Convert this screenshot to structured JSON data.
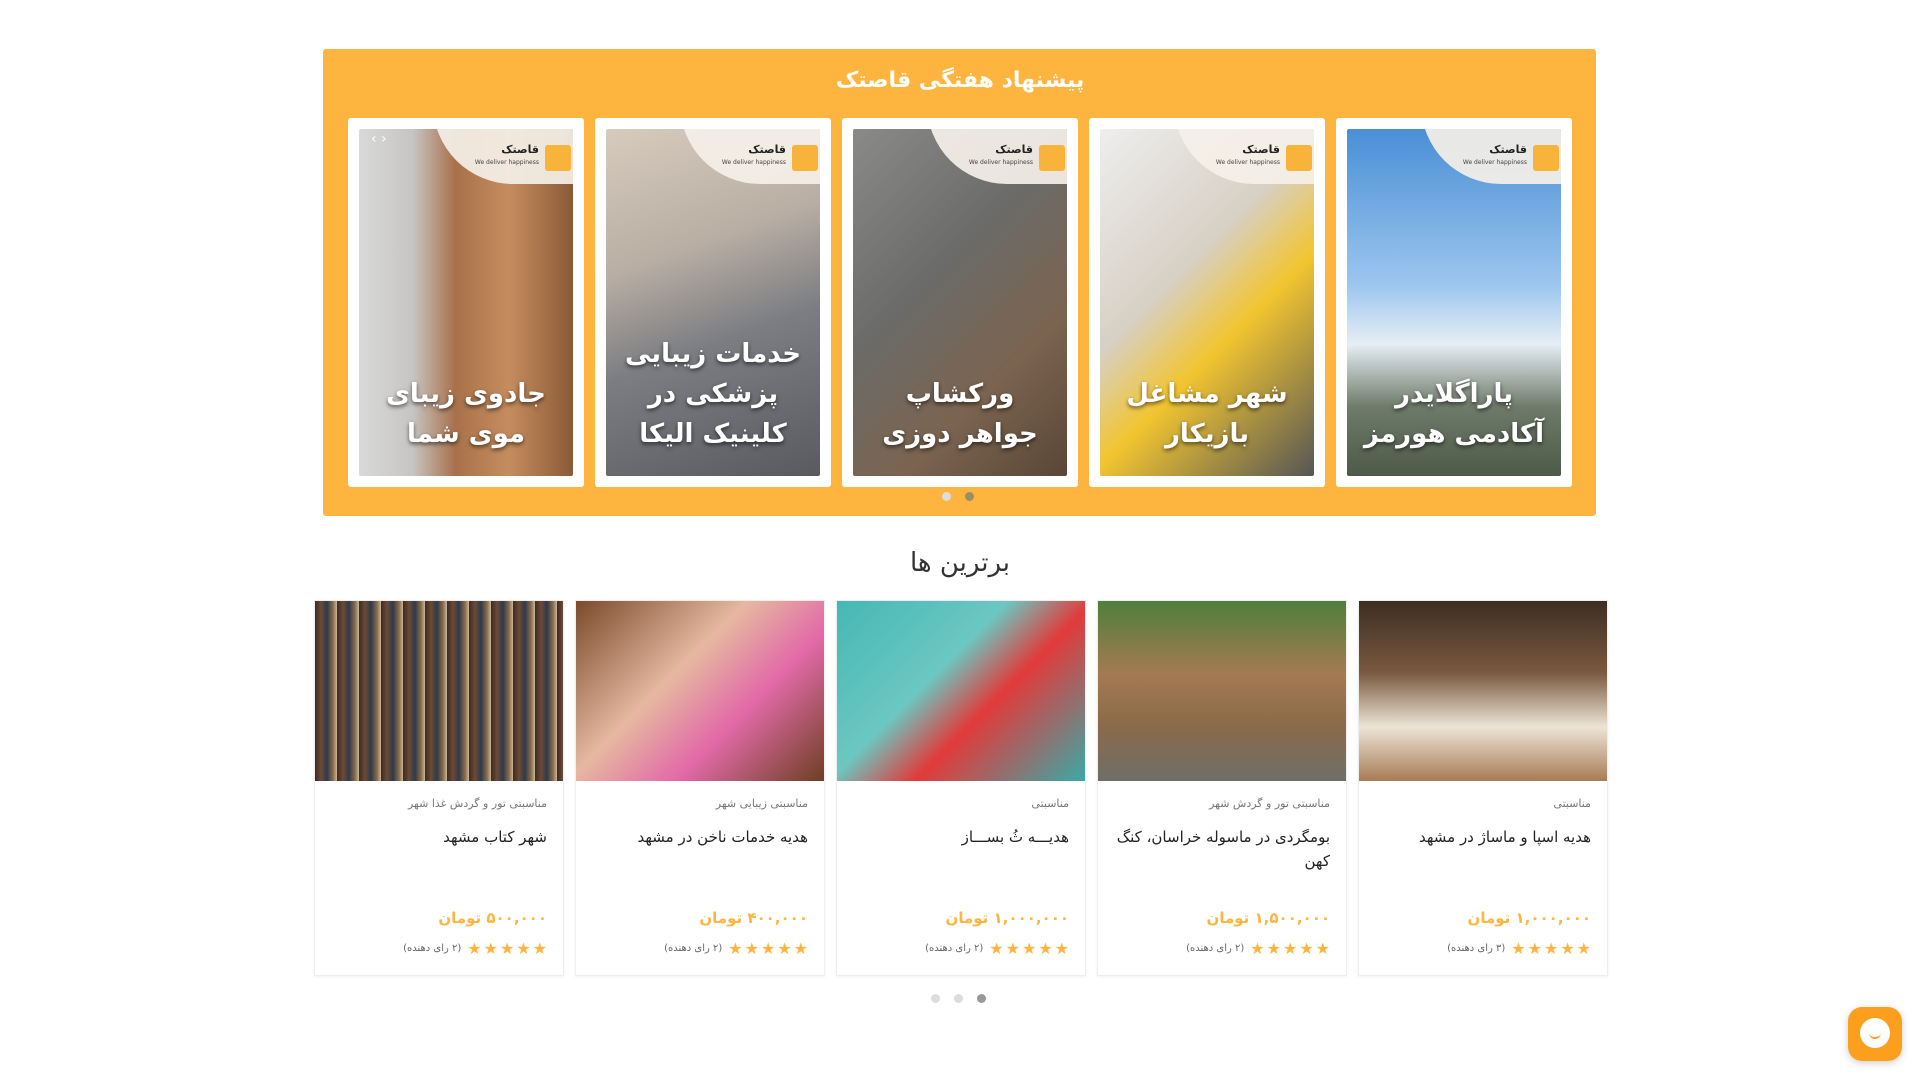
{
  "weekly": {
    "title": "پیشنهاد هفتگی قاصتک",
    "logo_name": "قاصتک",
    "logo_tagline": "We deliver happiness",
    "slides": [
      {
        "caption": "پاراگلایدر آکادمی هورمز",
        "bg": "linear-gradient(180deg,#4a8fd6 0%,#9cc6ee 45%,#e6eef5 62%,#6f7b6a 80%,#4d5a48 100%)"
      },
      {
        "caption": "شهر مشاغل بازیکار",
        "bg": "linear-gradient(135deg,#eee 0%,#d7d0c4 40%,#f2c530 60%,#555 100%)"
      },
      {
        "caption": "ورکشاپ جواهر دوزی",
        "bg": "linear-gradient(135deg,#8a8a88 0%,#6b6b69 40%,#7b6450 70%,#5a4636 100%)"
      },
      {
        "caption": "خدمات زیبایی پزشکی در کلینیک الیکا",
        "bg": "linear-gradient(160deg,#d6cbbd 0%,#b9aea3 35%,#7b7d82 60%,#585a60 100%)"
      },
      {
        "caption": "جادوی زیبای موی شما",
        "bg": "linear-gradient(90deg,#d9d9d9 0%,#c7c5c3 25%,#a8714a 45%,#c58d5e 70%,#8a5a37 100%)"
      }
    ],
    "dots": [
      false,
      true
    ]
  },
  "top": {
    "title": "برترین ها",
    "products": [
      {
        "category": "مناسبتی",
        "title": "هدیه اسپا و ماساژ در مشهد",
        "price": "۱,۰۰۰,۰۰۰ تومان",
        "votes": "(۳ رای دهنده)",
        "bg": "linear-gradient(180deg,#3d2d22 0%,#7a5a40 40%,#ede4d6 70%,#a77c56 100%)"
      },
      {
        "category": "مناسبتی تور و گردش شهر",
        "title": "بومگردی در ماسوله خراسان، کنگ کهن",
        "price": "۱,۵۰۰,۰۰۰ تومان",
        "votes": "(۲ رای دهنده)",
        "bg": "linear-gradient(180deg,#4f7f3a 0%,#a47a52 40%,#8a6a4a 70%,#6e6e68 100%)"
      },
      {
        "category": "مناسبتی",
        "title": "هدیـــه ثُ بســـاز",
        "price": "۱,۰۰۰,۰۰۰ تومان",
        "votes": "(۲ رای دهنده)",
        "bg": "linear-gradient(135deg,#45b8b4 0%,#6cc7c2 40%,#e23a3a 60%,#3aa9a6 100%)"
      },
      {
        "category": "مناسبتی زیبایی شهر",
        "title": "هدیه خدمات ناخن در مشهد",
        "price": "۴۰۰,۰۰۰ تومان",
        "votes": "(۲ رای دهنده)",
        "bg": "linear-gradient(135deg,#7a4a2a 0%,#e6b8a0 40%,#e26aa8 65%,#6e3f22 100%)"
      },
      {
        "category": "مناسبتی تور و گردش غذا شهر",
        "title": "شهر کتاب مشهد",
        "price": "۵۰۰,۰۰۰ تومان",
        "votes": "(۲ رای دهنده)",
        "bg": "repeating-linear-gradient(90deg,#3b2b22 0,#6d4a36 6px,#2e3a4a 12px,#8a6c4a 18px,#c9b79a 22px)"
      }
    ],
    "dots": [
      false,
      false,
      true
    ]
  },
  "colors": {
    "accent": "#fdb53f",
    "chat": "#fc9f1c"
  },
  "icons": {
    "star": "★",
    "chat": "chat-bubble-icon"
  }
}
